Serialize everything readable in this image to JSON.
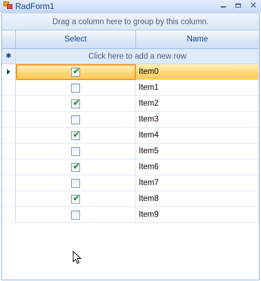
{
  "window": {
    "title": "RadForm1",
    "minimize": "_",
    "close": "✕"
  },
  "grid": {
    "group_panel_text": "Drag a column here to group by this column.",
    "columns": [
      "Select",
      "Name"
    ],
    "new_row_marker": "✱",
    "new_row_text": "Click here to add a new row",
    "rows": [
      {
        "name": "Item0",
        "checked": true,
        "current": true
      },
      {
        "name": "Item1",
        "checked": false
      },
      {
        "name": "Item2",
        "checked": true
      },
      {
        "name": "Item3",
        "checked": false
      },
      {
        "name": "Item4",
        "checked": true
      },
      {
        "name": "Item5",
        "checked": false
      },
      {
        "name": "Item6",
        "checked": true
      },
      {
        "name": "Item7",
        "checked": false
      },
      {
        "name": "Item8",
        "checked": true
      },
      {
        "name": "Item9",
        "checked": false
      }
    ]
  },
  "icons": {
    "app": "radform-app-icon",
    "current_row": "row-pointer-icon",
    "check": "checkmark-icon",
    "cursor": "mouse-pointer-icon"
  },
  "colors": {
    "header_text": "#15428b",
    "selected_row": "#ffd77a",
    "selected_border": "#f59a2f",
    "checkmark": "#2e9d2a"
  }
}
